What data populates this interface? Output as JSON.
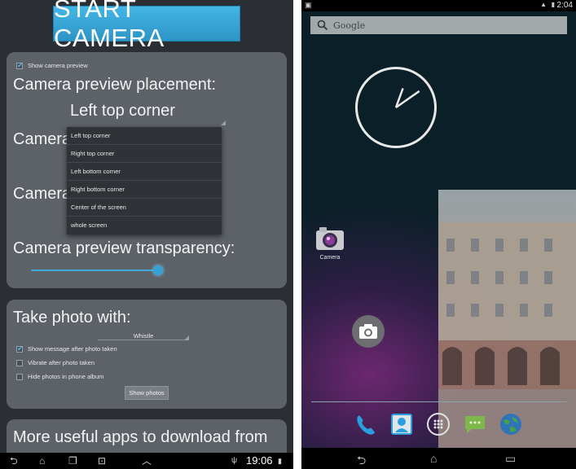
{
  "left_app": {
    "start_button": "START CAMERA",
    "show_preview_label": "Show camera preview",
    "placement_label": "Camera preview placement:",
    "placement_value": "Left top corner",
    "camera_label_1": "Camera",
    "camera_label_2": "Camera",
    "dropdown_options": [
      "Left top corner",
      "Right top corner",
      "Left bottom corner",
      "Right bottom corner",
      "Center of the screen",
      "whole screen"
    ],
    "transparency_label": "Camera preview transparency:",
    "transparency_value": 0.96,
    "take_photo_label": "Take photo with:",
    "take_photo_value": "Whistle",
    "options": [
      {
        "label": "Show message after photo taken",
        "checked": true
      },
      {
        "label": "Vibrate after photo taken",
        "checked": false
      },
      {
        "label": "Hide photos in phone album",
        "checked": false
      }
    ],
    "show_photos_button": "Show photos",
    "more_apps_text": "More useful apps to download from",
    "nav_time": "19:06",
    "accent_color": "#3ea6d8"
  },
  "right_home": {
    "status_time": "2:04",
    "search_placeholder": "Google",
    "camera_app_label": "Camera",
    "clock_hour_deg": 20,
    "clock_minute_deg": 55,
    "dock_icons": [
      "phone-icon",
      "contacts-icon",
      "apps-grid-icon",
      "messaging-icon",
      "browser-globe-icon"
    ],
    "nav_icons": [
      "back-icon",
      "home-icon",
      "recents-icon"
    ]
  }
}
